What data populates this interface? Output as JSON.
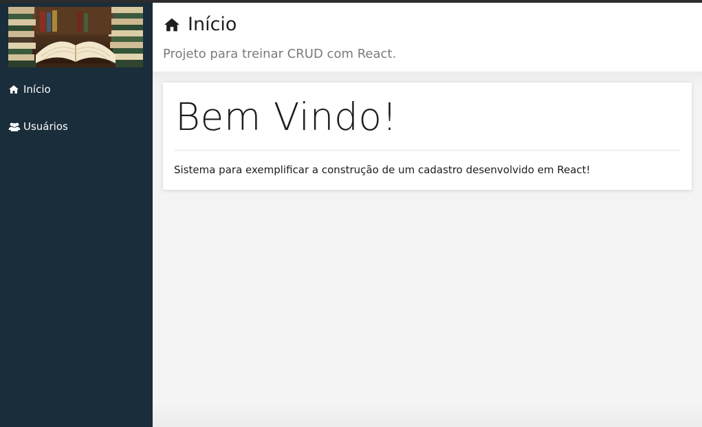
{
  "sidebar": {
    "logo_icon": "books-photo",
    "items": [
      {
        "label": "Início",
        "icon": "home-icon"
      },
      {
        "label": "Usuários",
        "icon": "users-icon"
      }
    ]
  },
  "header": {
    "title": "Início",
    "title_icon": "home-icon",
    "subtitle": "Projeto para treinar CRUD com React."
  },
  "main": {
    "heading": "Bem Vindo!",
    "text": "Sistema para exemplificar a construção de um cadastro desenvolvido em React!"
  },
  "colors": {
    "sidebar_bg": "#1a2d3a",
    "page_bg": "#f4f4f4",
    "card_bg": "#ffffff"
  }
}
